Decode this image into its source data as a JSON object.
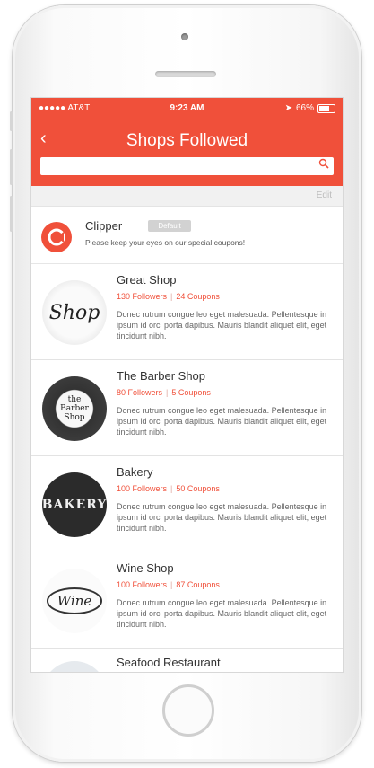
{
  "status_bar": {
    "carrier": "●●●●● AT&T",
    "time": "9:23 AM",
    "battery": "66%"
  },
  "header": {
    "back_icon": "‹",
    "title": "Shops Followed",
    "search_placeholder": ""
  },
  "edit_label": "Edit",
  "clipper": {
    "name": "Clipper",
    "badge": "Default",
    "message": "Please keep your eyes on our special coupons!"
  },
  "shops": [
    {
      "name": "Great Shop",
      "followers": "130 Followers",
      "coupons": "24 Coupons",
      "desc": "Donec rutrum congue leo eget malesuada. Pellentesque in ipsum id orci porta dapibus. Mauris blandit aliquet elit, eget tincidunt nibh.",
      "logo_text": "Shop"
    },
    {
      "name": "The Barber Shop",
      "followers": "80 Followers",
      "coupons": "5 Coupons",
      "desc": "Donec rutrum congue leo eget malesuada. Pellentesque in ipsum id orci porta dapibus. Mauris blandit aliquet elit, eget tincidunt nibh.",
      "logo_text": "the Barber Shop"
    },
    {
      "name": "Bakery",
      "followers": "100 Followers",
      "coupons": "50 Coupons",
      "desc": "Donec rutrum congue leo eget malesuada. Pellentesque in ipsum id orci porta dapibus. Mauris blandit aliquet elit, eget tincidunt nibh.",
      "logo_text": "BAKERY"
    },
    {
      "name": "Wine Shop",
      "followers": "100 Followers",
      "coupons": "87 Coupons",
      "desc": "Donec rutrum congue leo eget malesuada. Pellentesque in ipsum id orci porta dapibus. Mauris blandit aliquet elit, eget tincidunt nibh.",
      "logo_text": "Wine"
    }
  ],
  "last_shop": {
    "name": "Seafood Restaurant"
  },
  "colors": {
    "accent": "#f0503a"
  }
}
